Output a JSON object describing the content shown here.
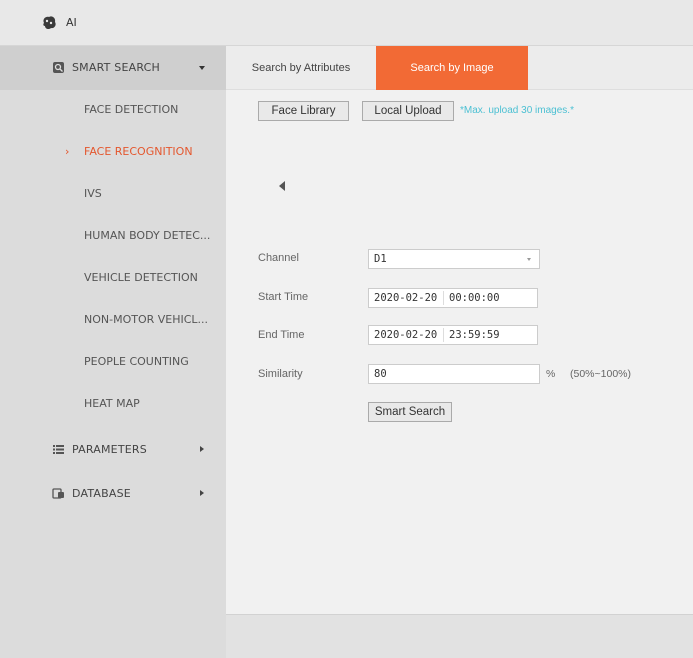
{
  "header": {
    "title": "AI",
    "icon": "ai-brain-icon"
  },
  "sidebar": {
    "smart_search": {
      "label": "SMART SEARCH",
      "icon": "smart-search-icon"
    },
    "items": [
      {
        "label": "FACE DETECTION"
      },
      {
        "label": "FACE RECOGNITION",
        "active": true,
        "marker": "›"
      },
      {
        "label": "IVS"
      },
      {
        "label": "HUMAN BODY DETEC..."
      },
      {
        "label": "VEHICLE DETECTION"
      },
      {
        "label": "NON-MOTOR VEHICL..."
      },
      {
        "label": "PEOPLE COUNTING"
      },
      {
        "label": "HEAT MAP"
      }
    ],
    "parameters": {
      "label": "PARAMETERS",
      "icon": "list-icon"
    },
    "database": {
      "label": "DATABASE",
      "icon": "database-icon"
    }
  },
  "tabs": [
    {
      "label": "Search by Attributes"
    },
    {
      "label": "Search by Image",
      "active": true
    }
  ],
  "upload": {
    "face_library": "Face Library",
    "local_upload": "Local Upload",
    "hint": "*Max. upload 30 images.*"
  },
  "form": {
    "channel_label": "Channel",
    "channel_value": "D1",
    "start_label": "Start Time",
    "start_date": "2020-02-20",
    "start_time": "00:00:00",
    "end_label": "End Time",
    "end_date": "2020-02-20",
    "end_time": "23:59:59",
    "similarity_label": "Similarity",
    "similarity_value": "80",
    "similarity_unit": "%",
    "similarity_range": "(50%~100%)",
    "search_button": "Smart Search"
  },
  "colors": {
    "accent": "#f26a35",
    "active_text": "#e4572e",
    "hint": "#4cc0d3"
  }
}
